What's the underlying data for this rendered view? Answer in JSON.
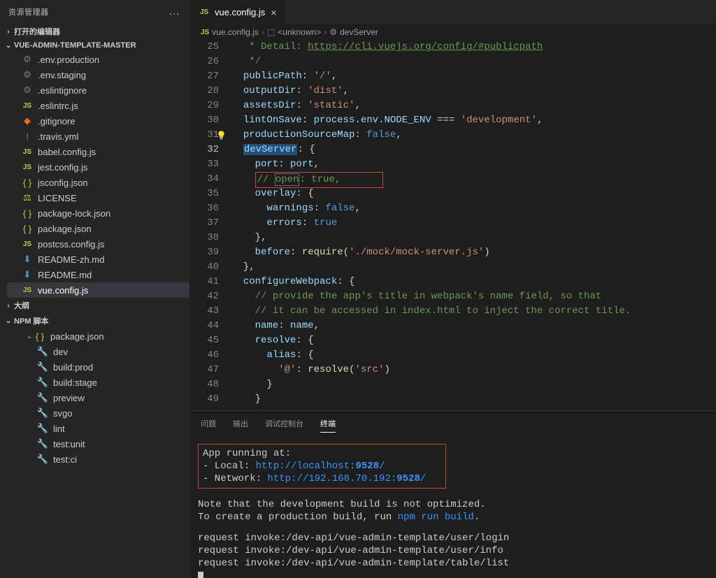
{
  "explorer": {
    "title": "资源管理器",
    "openEditors": "打开的编辑器",
    "project": "VUE-ADMIN-TEMPLATE-MASTER",
    "outline": "大纲",
    "npmScripts": "NPM 脚本",
    "files": [
      {
        "icon": "gear",
        "name": ".env.production"
      },
      {
        "icon": "gear",
        "name": ".env.staging"
      },
      {
        "icon": "gear",
        "name": ".eslintignore"
      },
      {
        "icon": "js",
        "name": ".eslintrc.js"
      },
      {
        "icon": "git",
        "name": ".gitignore"
      },
      {
        "icon": "yml",
        "name": ".travis.yml"
      },
      {
        "icon": "js",
        "name": "babel.config.js"
      },
      {
        "icon": "js",
        "name": "jest.config.js"
      },
      {
        "icon": "json",
        "name": "jsconfig.json"
      },
      {
        "icon": "lic",
        "name": "LICENSE"
      },
      {
        "icon": "json",
        "name": "package-lock.json"
      },
      {
        "icon": "json",
        "name": "package.json"
      },
      {
        "icon": "js",
        "name": "postcss.config.js"
      },
      {
        "icon": "md",
        "name": "README-zh.md"
      },
      {
        "icon": "md",
        "name": "README.md"
      },
      {
        "icon": "js",
        "name": "vue.config.js",
        "active": true
      }
    ],
    "npm": {
      "root": "package.json",
      "scripts": [
        "dev",
        "build:prod",
        "build:stage",
        "preview",
        "svgo",
        "lint",
        "test:unit",
        "test:ci"
      ]
    }
  },
  "tab": {
    "label": "vue.config.js"
  },
  "breadcrumb": {
    "file": "vue.config.js",
    "sym1": "<unknown>",
    "sym2": "devServer"
  },
  "editor": {
    "startLine": 25,
    "currentLine": 32,
    "lightbulbLine": 31,
    "docUrl": "https://cli.vuejs.org/config/#publicpath"
  },
  "panel": {
    "tabs": [
      "问题",
      "输出",
      "调试控制台",
      "终端"
    ],
    "active": 3,
    "run": {
      "title": "App running at:",
      "localLabel": "- Local:   ",
      "localUrl": "http://localhost:",
      "localPort": "9528",
      "netLabel": "- Network: ",
      "netUrl": "http://192.168.70.192:",
      "netPort": "9528"
    },
    "note1": "Note that the development build is not optimized.",
    "note2a": "To create a production build, run ",
    "note2b": "npm run build",
    "req1": "request invoke:/dev-api/vue-admin-template/user/login",
    "req2": "request invoke:/dev-api/vue-admin-template/user/info",
    "req3": "request invoke:/dev-api/vue-admin-template/table/list"
  }
}
